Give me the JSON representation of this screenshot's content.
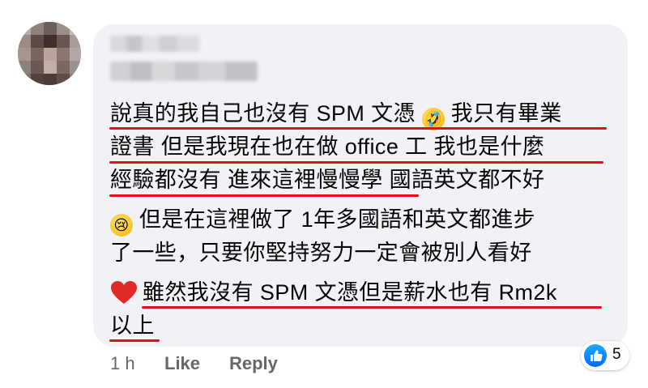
{
  "comment": {
    "lines": [
      "說真的我自己也沒有 SPM 文憑",
      "我只有畢業",
      "證書 但是我現在也在做 office 工 我也是什麼",
      "經驗都沒有 進來這裡慢慢學 國語英文都不好",
      "但是在這裡做了 1年多國語和英文都進步",
      "了一些，只要你堅持努力一定會被別人看好",
      "雖然我沒有 SPM 文憑但是薪水也有 Rm2k",
      "以上"
    ],
    "emojis": {
      "laugh": "🤣",
      "cry": "😢",
      "heart": "heart-icon"
    }
  },
  "actions": {
    "time": "1 h",
    "like": "Like",
    "reply": "Reply"
  },
  "reactions": {
    "count": "5",
    "icon": "thumbs-up-icon"
  },
  "colors": {
    "underline": "#e0101e",
    "bubble": "#f0f2f5",
    "meta_text": "#65676b",
    "like_blue": "#0866ff"
  }
}
